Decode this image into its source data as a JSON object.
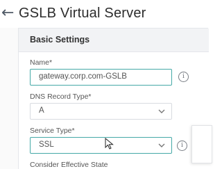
{
  "header": {
    "back_icon": "←",
    "title": "GSLB Virtual Server"
  },
  "panel": {
    "title": "Basic Settings"
  },
  "fields": {
    "name": {
      "label": "Name*",
      "value": "gateway.corp.com-GSLB"
    },
    "dns_record_type": {
      "label": "DNS Record Type*",
      "value": "A"
    },
    "service_type": {
      "label": "Service Type*",
      "value": "SSL"
    },
    "consider_effective_state": {
      "label": "Consider Effective State"
    }
  },
  "icons": {
    "info": "i",
    "chevron": "chevron-down-icon"
  },
  "colors": {
    "active_border": "#45a9a7",
    "panel_header_bg": "#f2f3f5"
  }
}
